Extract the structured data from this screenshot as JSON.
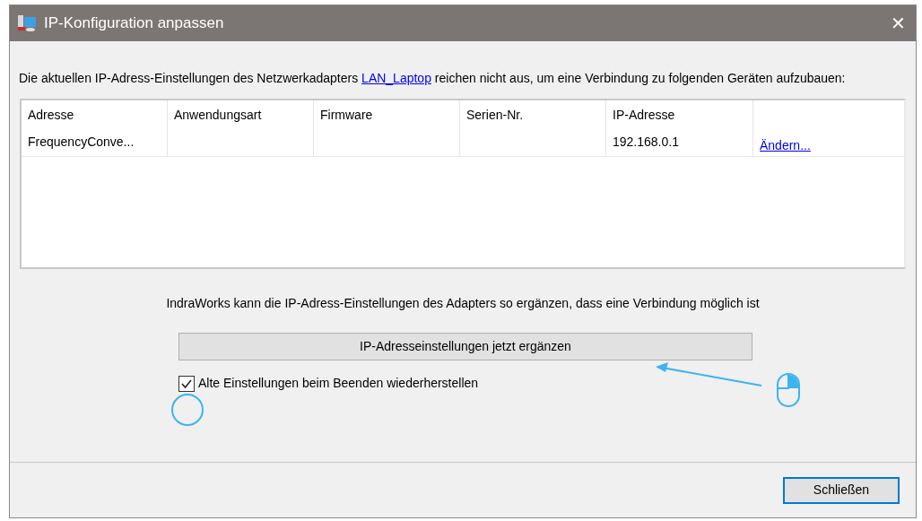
{
  "window": {
    "title": "IP-Konfiguration anpassen",
    "close": "✕"
  },
  "intro": {
    "before": "Die aktuellen IP-Adress-Einstellungen des Netzwerkadapters ",
    "link": "LAN_Laptop",
    "after": " reichen nicht aus, um eine Verbindung zu folgenden Geräten aufzubauen:"
  },
  "table": {
    "columns": [
      "Adresse",
      "Anwendungsart",
      "Firmware",
      "Serien-Nr.",
      "IP-Adresse"
    ],
    "rows": [
      {
        "cells": [
          "FrequencyConve...",
          "",
          "",
          "",
          "192.168.0.1"
        ],
        "action": "Ändern..."
      }
    ]
  },
  "info": "IndraWorks kann die IP-Adress-Einstellungen des Adapters so ergänzen, dass eine Verbindung möglich ist",
  "apply_button": "IP-Adresseinstellungen jetzt ergänzen",
  "restore_checkbox": {
    "label": "Alte Einstellungen beim Beenden wiederherstellen",
    "checked": true
  },
  "close_button": "Schließen"
}
